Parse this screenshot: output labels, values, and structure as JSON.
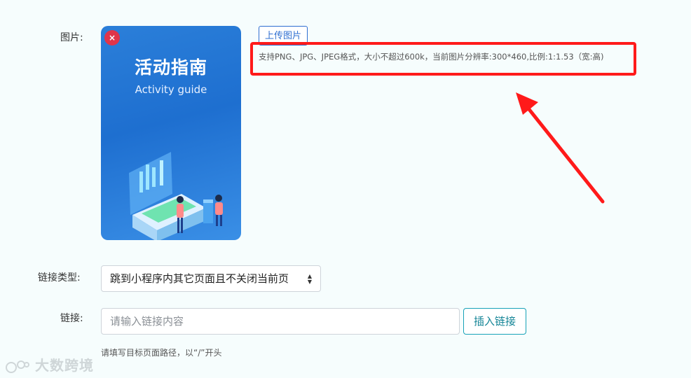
{
  "form": {
    "image_label": "图片:",
    "link_type_label": "链接类型:",
    "link_label": "链接:"
  },
  "poster": {
    "title": "活动指南",
    "subtitle": "Activity guide",
    "remove_symbol": "×"
  },
  "upload": {
    "button_label": "上传图片",
    "hint": "支持PNG、JPG、JPEG格式，大小不超过600k，当前图片分辨率:300*460,比例:1:1.53（宽:高)"
  },
  "link_type": {
    "selected": "跳到小程序内其它页面且不关闭当前页"
  },
  "link": {
    "placeholder": "请输入链接内容",
    "value": "",
    "insert_button": "插入链接",
    "hint": "请填写目标页面路径，以“/”开头"
  },
  "watermark": {
    "text": "大数跨境"
  },
  "colors": {
    "highlight": "#ff1a1a",
    "upload_accent": "#2f6fd1",
    "insert_accent": "#17a2b8",
    "remove_badge": "#e0354a"
  },
  "icons": {
    "select_caret": "sort-caret-icon",
    "annotation_arrow": "arrow-icon"
  }
}
